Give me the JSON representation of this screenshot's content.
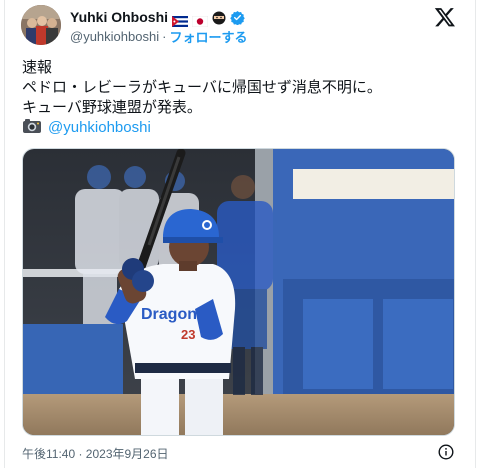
{
  "author": {
    "display_name": "Yuhki Ohboshi",
    "handle": "@yuhkiohboshi",
    "separator": "·",
    "follow_label": "フォローする",
    "badges": [
      "cuba-flag",
      "japan-flag",
      "ninja-emoji",
      "verified-badge"
    ]
  },
  "tweet": {
    "lines": [
      "速報",
      "ペドロ・レビーラがキューバに帰国せず消息不明に。",
      "キューバ野球連盟が発表。"
    ],
    "camera_emoji": "camera-icon",
    "mention": "@yuhkiohboshi"
  },
  "media": {
    "alt": "baseball-batter-photo",
    "jersey_number": "23"
  },
  "footer": {
    "timestamp": "午後11:40 · 2023年9月26日"
  },
  "colors": {
    "link": "#1d9bf0",
    "text": "#0f1419",
    "muted": "#536471",
    "verified": "#1d9bf0"
  }
}
